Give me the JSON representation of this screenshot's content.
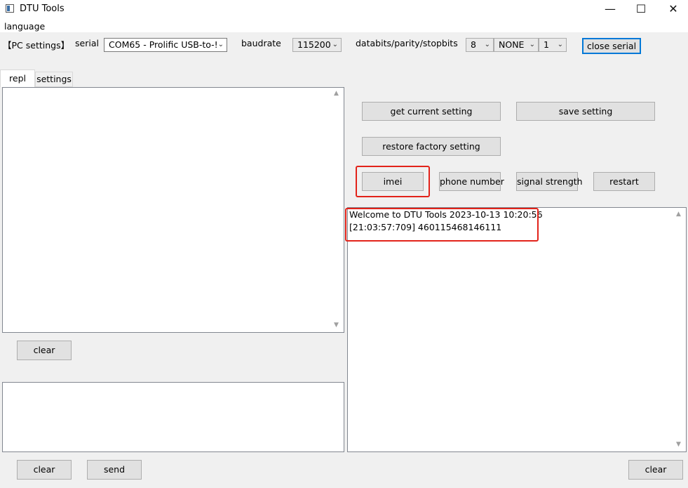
{
  "window": {
    "title": "DTU Tools",
    "minimize": "—",
    "maximize": "☐",
    "close": "✕"
  },
  "menu": {
    "language": "language"
  },
  "toolbar": {
    "pc_settings": "【PC settings】",
    "serial_label": "serial",
    "serial_value": "COM65 - Prolific USB-to-!",
    "baudrate_label": "baudrate",
    "baudrate_value": "115200",
    "dps_label": "databits/parity/stopbits",
    "databits_value": "8",
    "parity_value": "NONE",
    "stopbits_value": "1",
    "close_serial": "close serial"
  },
  "tabs": {
    "repl": "repl",
    "settings": "settings"
  },
  "left": {
    "clear_top": "clear",
    "clear_bottom": "clear",
    "send": "send"
  },
  "right": {
    "get_current_setting": "get current setting",
    "save_setting": "save setting",
    "restore_factory_setting": "restore factory setting",
    "imei": "imei",
    "phone_number": "phone number",
    "signal_strength": "signal strength",
    "restart": "restart",
    "clear": "clear",
    "log": [
      "Welcome to DTU Tools 2023-10-13 10:20:56",
      "[21:03:57:709] 460115468146111"
    ]
  },
  "colors": {
    "highlight": "#e2231a",
    "accent": "#0078d7"
  }
}
